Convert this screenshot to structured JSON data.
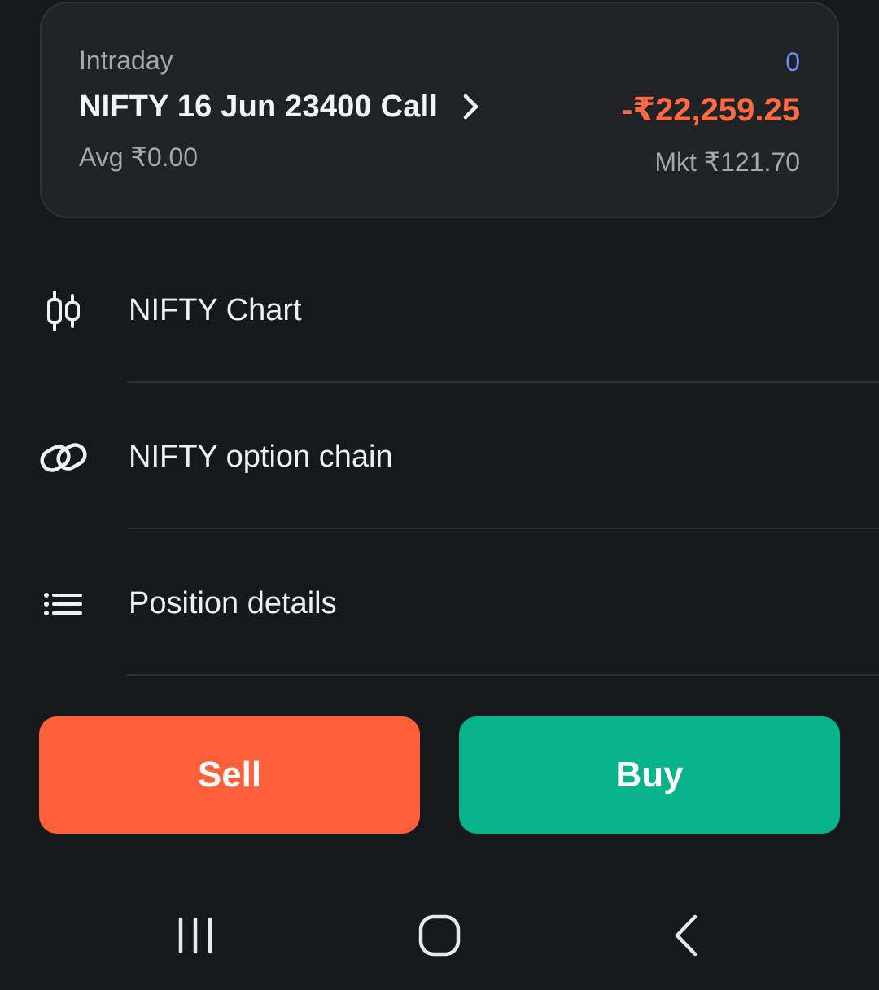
{
  "position": {
    "product": "Intraday",
    "instrument": "NIFTY 16 Jun 23400 Call",
    "avg_price": "Avg ₹0.00",
    "quantity": "0",
    "pnl": "-₹22,259.25",
    "market_price": "Mkt ₹121.70"
  },
  "menu": {
    "items": [
      {
        "label": "NIFTY Chart",
        "icon": "candlestick-chart-icon"
      },
      {
        "label": "NIFTY option chain",
        "icon": "link-icon"
      },
      {
        "label": "Position details",
        "icon": "list-icon"
      }
    ]
  },
  "actions": {
    "sell_label": "Sell",
    "buy_label": "Buy"
  },
  "colors": {
    "background": "#16191b",
    "card": "#202326",
    "sell": "#ff5f3a",
    "buy": "#06b38a",
    "loss": "#ff6a42",
    "quantity": "#6f8cf4"
  },
  "system_nav": {
    "icons": [
      "recent-apps-icon",
      "home-icon",
      "back-icon"
    ]
  }
}
